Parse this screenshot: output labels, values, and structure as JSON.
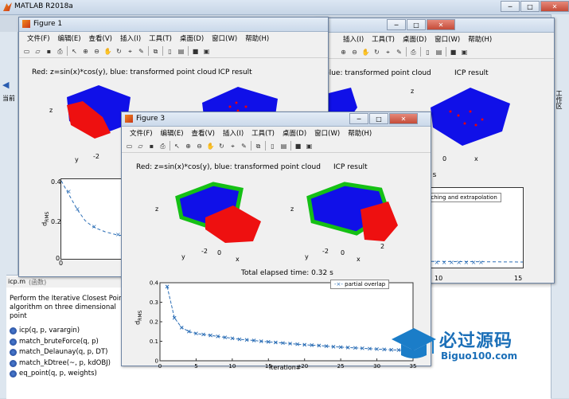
{
  "main": {
    "title": "MATLAB R2018a",
    "side_left_label": "当前",
    "side_right_label": "工作区"
  },
  "figure1": {
    "title": "Figure 1",
    "menu": [
      "文件(F)",
      "编辑(E)",
      "查看(V)",
      "插入(I)",
      "工具(T)",
      "桌面(D)",
      "窗口(W)",
      "帮助(H)"
    ],
    "left_title": "Red: z=sin(x)*cos(y), blue: transformed point cloud",
    "right_title": "ICP result",
    "zlabel": "z",
    "ylabel": "y",
    "xlabel": "x",
    "tick_neg2": "-2",
    "tick_0": "0",
    "rms_label": "d",
    "rms_sub": "RMS",
    "ytick_04": "0.4",
    "ytick_02": "0.2",
    "ytick_0": "0",
    "xtick_0": "0",
    "xtick_10": "10",
    "xtick_15": "15",
    "elapsed_tail": "4 s",
    "legend": "ree matching and extrapolation"
  },
  "figure3": {
    "title": "Figure 3",
    "menu": [
      "文件(F)",
      "编辑(E)",
      "查看(V)",
      "插入(I)",
      "工具(T)",
      "桌面(D)",
      "窗口(W)",
      "帮助(H)"
    ],
    "left_title": "Red: z=sin(x)*cos(y), blue: transformed point cloud",
    "right_title": "ICP result",
    "zlabel": "z",
    "ylabel": "y",
    "xlabel": "x",
    "tick_neg2": "-2",
    "tick_0": "0",
    "tick_2": "2",
    "elapsed": "Total elapsed time: 0.32 s",
    "legend": "partial overlap",
    "xlabel_chart": "iteration#",
    "rms_label": "d",
    "rms_sub": "RMS"
  },
  "workspace": {
    "file_label": "icp.m",
    "file_hint": "(函数)",
    "description": "Perform the Iterative Closest Point algorithm on three dimensional point",
    "functions": [
      "icp(q, p, varargin)",
      "match_bruteForce(q, p)",
      "match_Delaunay(q, p, DT)",
      "match_kDtree(~, p, kdOBJ)",
      "eq_point(q, p, weights)"
    ]
  },
  "watermark": {
    "cn": "必过源码",
    "en": "Biguo100.com"
  },
  "chart_data": [
    {
      "type": "line",
      "title": "",
      "xlabel": "iteration#",
      "ylabel": "dRMS",
      "xlim": [
        0,
        35
      ],
      "ylim": [
        0,
        0.4
      ],
      "xticks": [
        0,
        5,
        10,
        15,
        20,
        25,
        30,
        35
      ],
      "yticks": [
        0,
        0.1,
        0.2,
        0.3,
        0.4
      ],
      "series": [
        {
          "name": "partial overlap",
          "x": [
            1,
            2,
            3,
            4,
            5,
            6,
            7,
            8,
            9,
            10,
            11,
            12,
            13,
            14,
            15,
            16,
            17,
            18,
            19,
            20,
            21,
            22,
            23,
            24,
            25,
            26,
            27,
            28,
            29,
            30,
            31,
            32,
            33,
            34,
            35
          ],
          "y": [
            0.38,
            0.22,
            0.17,
            0.15,
            0.14,
            0.135,
            0.13,
            0.125,
            0.12,
            0.115,
            0.11,
            0.107,
            0.104,
            0.1,
            0.097,
            0.094,
            0.091,
            0.088,
            0.085,
            0.082,
            0.08,
            0.078,
            0.075,
            0.072,
            0.07,
            0.068,
            0.066,
            0.064,
            0.062,
            0.06,
            0.058,
            0.056,
            0.055,
            0.053,
            0.052
          ]
        }
      ]
    },
    {
      "type": "line",
      "title": "",
      "xlabel": "",
      "ylabel": "dRMS",
      "xlim": [
        0,
        15
      ],
      "ylim": [
        0,
        0.4
      ],
      "series": [
        {
          "name": "",
          "x": [
            0,
            1,
            2,
            3,
            4,
            5,
            6
          ],
          "y": [
            0.42,
            0.35,
            0.25,
            0.19,
            0.16,
            0.14,
            0.13
          ]
        }
      ]
    }
  ]
}
